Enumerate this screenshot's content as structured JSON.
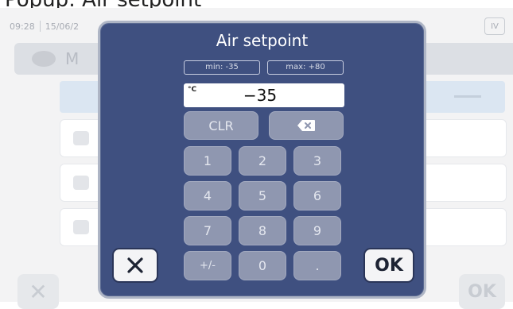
{
  "caption": "Popup: Air setpoint",
  "background": {
    "time": "09:28",
    "date": "15/06/2",
    "badge": "IV",
    "header_text": "M",
    "cancel_glyph": "✕",
    "ok_label": "OK"
  },
  "modal": {
    "title": "Air setpoint",
    "min_label": "min: -35",
    "max_label": "max: +80",
    "unit": "°C",
    "value": "−35",
    "clear_label": "CLR",
    "keys": {
      "k1": "1",
      "k2": "2",
      "k3": "3",
      "k4": "4",
      "k5": "5",
      "k6": "6",
      "k7": "7",
      "k8": "8",
      "k9": "9",
      "sign": "+/-",
      "k0": "0",
      "dot": "."
    },
    "cancel_glyph": "✕",
    "ok_label": "OK"
  },
  "colors": {
    "modal_bg": "#3f5080",
    "key_bg": "#8f97b0",
    "display_bg": "#ffffff"
  }
}
